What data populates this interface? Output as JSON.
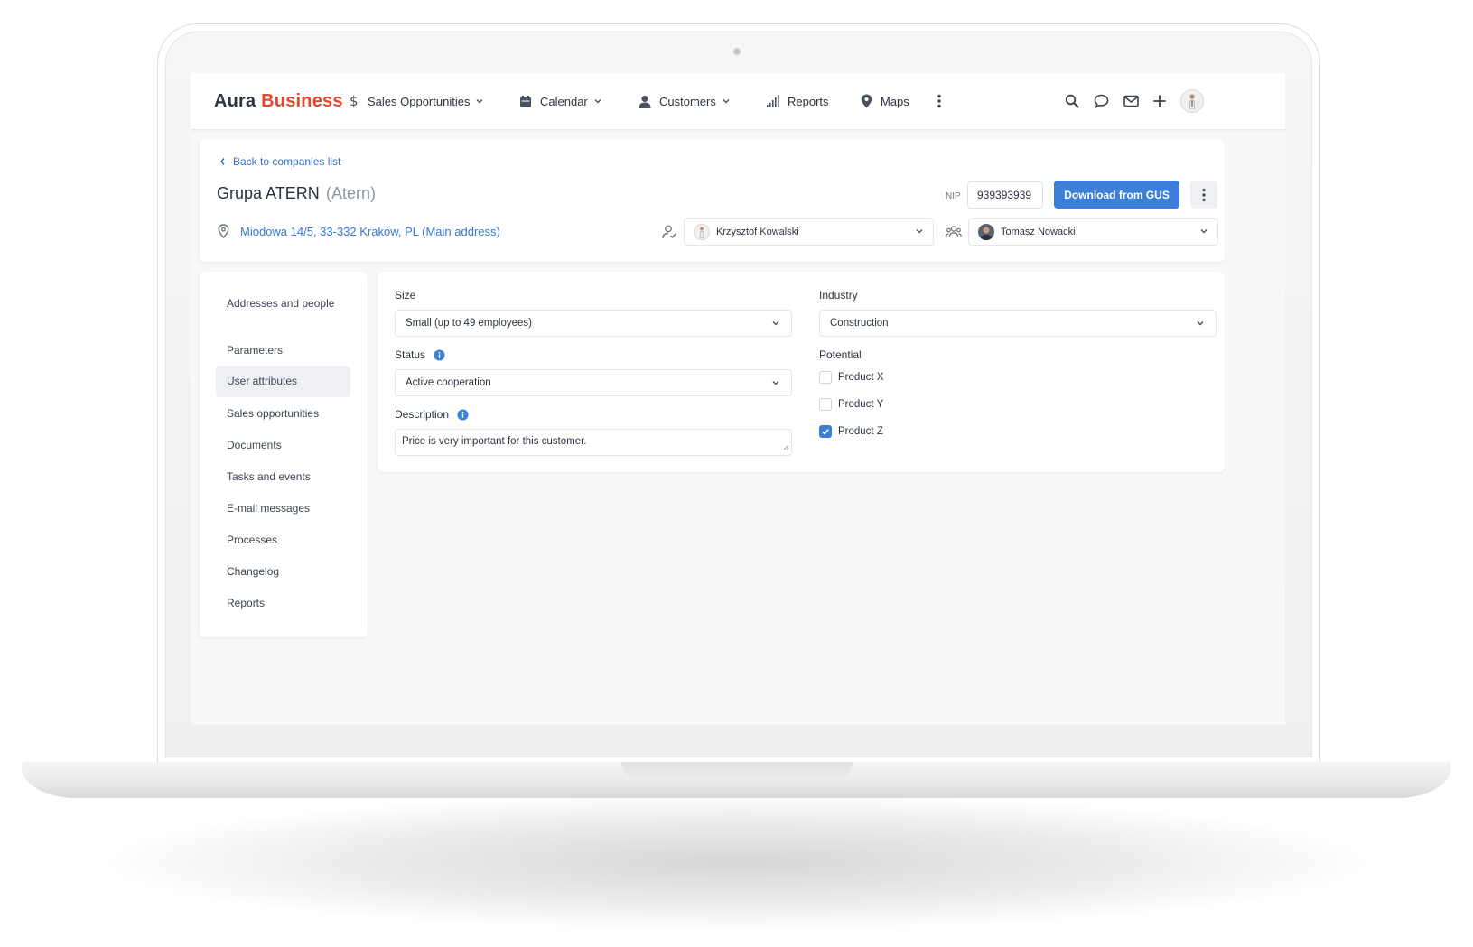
{
  "app": {
    "logo_part1": "Aura",
    "logo_part2": "Business",
    "brand_color": "#e4472f",
    "accent_color": "#3b7fd8"
  },
  "nav": {
    "items": [
      {
        "label": "Sales Opportunities",
        "icon": "dollar-icon",
        "has_dropdown": true
      },
      {
        "label": "Calendar",
        "icon": "calendar-icon",
        "has_dropdown": true
      },
      {
        "label": "Customers",
        "icon": "user-icon",
        "has_dropdown": true
      },
      {
        "label": "Reports",
        "icon": "bar-chart-icon",
        "has_dropdown": false
      },
      {
        "label": "Maps",
        "icon": "map-pin-icon",
        "has_dropdown": false
      }
    ],
    "right_icons": [
      "search-icon",
      "chat-icon",
      "mail-icon",
      "plus-icon",
      "avatar"
    ]
  },
  "company": {
    "back_link": "Back to companies list",
    "name": "Grupa ATERN",
    "alias": "(Atern)",
    "address": "Miodowa 14/5, 33-332 Kraków, PL (Main address)",
    "nip_label": "NIP",
    "nip_value": "939393939",
    "gus_button": "Download from GUS",
    "owner": "Krzysztof Kowalski",
    "team_member": "Tomasz Nowacki"
  },
  "sidebar": {
    "items": [
      {
        "label": "Addresses and people",
        "active": false
      },
      {
        "label": "Parameters",
        "active": false
      },
      {
        "label": "User attributes",
        "active": true
      },
      {
        "label": "Sales opportunities",
        "active": false
      },
      {
        "label": "Documents",
        "active": false
      },
      {
        "label": "Tasks and events",
        "active": false
      },
      {
        "label": "E-mail messages",
        "active": false
      },
      {
        "label": "Processes",
        "active": false
      },
      {
        "label": "Changelog",
        "active": false
      },
      {
        "label": "Reports",
        "active": false
      }
    ]
  },
  "form": {
    "size": {
      "label": "Size",
      "value": "Small (up to 49 employees)"
    },
    "industry": {
      "label": "Industry",
      "value": "Construction"
    },
    "status": {
      "label": "Status",
      "value": "Active cooperation"
    },
    "description": {
      "label": "Description",
      "value": "Price is very important for this customer."
    },
    "potential": {
      "label": "Potential",
      "options": [
        {
          "label": "Product X",
          "checked": false
        },
        {
          "label": "Product Y",
          "checked": false
        },
        {
          "label": "Product Z",
          "checked": true
        }
      ]
    }
  }
}
